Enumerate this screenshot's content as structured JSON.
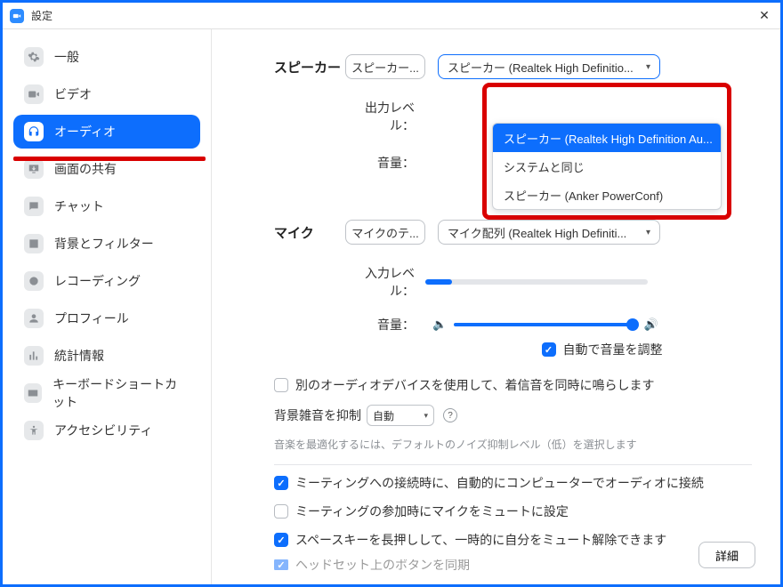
{
  "window": {
    "title": "設定"
  },
  "sidebar": {
    "items": [
      {
        "label": "一般"
      },
      {
        "label": "ビデオ"
      },
      {
        "label": "オーディオ"
      },
      {
        "label": "画面の共有"
      },
      {
        "label": "チャット"
      },
      {
        "label": "背景とフィルター"
      },
      {
        "label": "レコーディング"
      },
      {
        "label": "プロフィール"
      },
      {
        "label": "統計情報"
      },
      {
        "label": "キーボードショートカット"
      },
      {
        "label": "アクセシビリティ"
      }
    ]
  },
  "speaker": {
    "section_label": "スピーカー",
    "test_btn": "スピーカー...",
    "selected": "スピーカー (Realtek High Definitio...",
    "options": [
      "スピーカー (Realtek High Definition Au...",
      "システムと同じ",
      "スピーカー (Anker PowerConf)"
    ],
    "output_level_label": "出力レベル：",
    "volume_label": "音量："
  },
  "mic": {
    "section_label": "マイク",
    "test_btn": "マイクのテ...",
    "selected": "マイク配列 (Realtek High Definiti...",
    "input_level_label": "入力レベル：",
    "volume_label": "音量：",
    "auto_volume": "自動で音量を調整"
  },
  "options": {
    "separate_ringtone": "別のオーディオデバイスを使用して、着信音を同時に鳴らします",
    "noise_suppress_label": "背景雑音を抑制",
    "noise_suppress_value": "自動",
    "hint": "音楽を最適化するには、デフォルトのノイズ抑制レベル（低）を選択します",
    "auto_join_audio": "ミーティングへの接続時に、自動的にコンピューターでオーディオに接続",
    "mute_on_join": "ミーティングの参加時にマイクをミュートに設定",
    "space_unmute": "スペースキーを長押しして、一時的に自分をミュート解除できます",
    "headset_sync": "ヘッドセット上のボタンを同期"
  },
  "detail_btn": "詳細"
}
